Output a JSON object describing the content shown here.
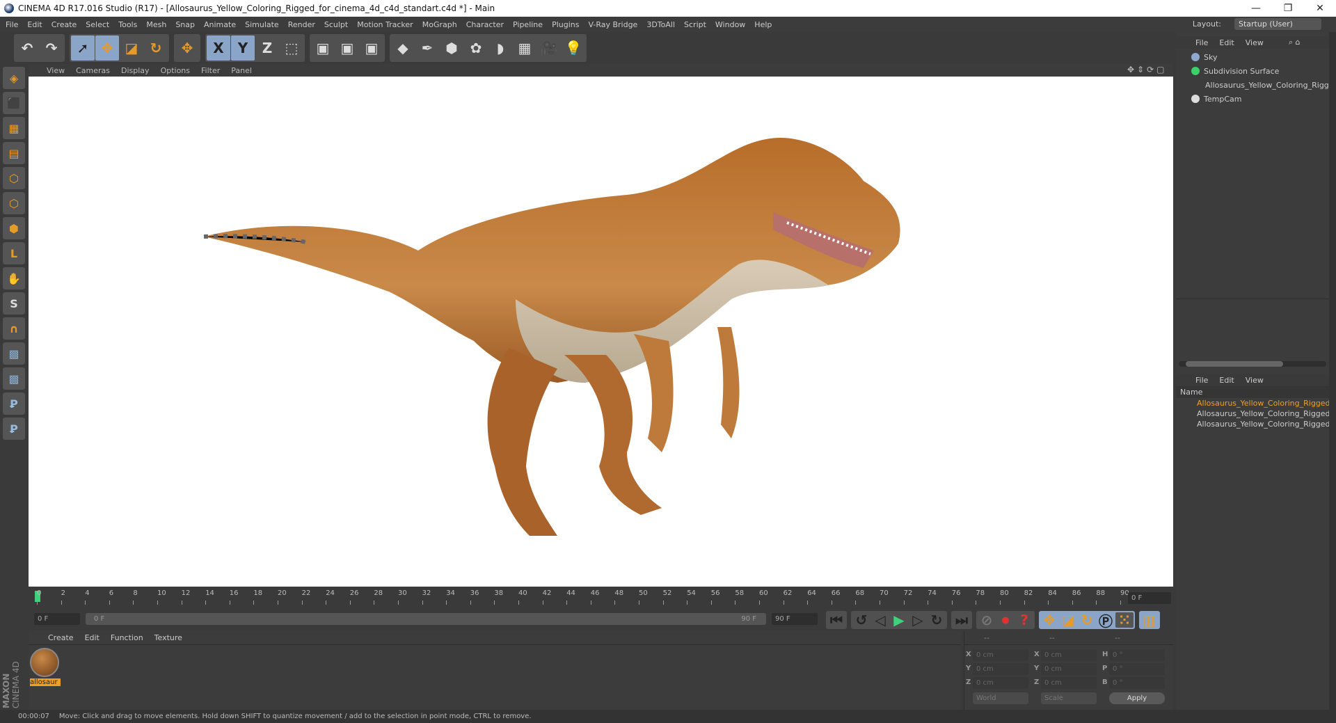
{
  "window": {
    "title": "CINEMA 4D R17.016 Studio (R17) - [Allosaurus_Yellow_Coloring_Rigged_for_cinema_4d_c4d_standart.c4d *] - Main",
    "minimize": "—",
    "restore": "❐",
    "close": "✕"
  },
  "menu": [
    "File",
    "Edit",
    "Create",
    "Select",
    "Tools",
    "Mesh",
    "Snap",
    "Animate",
    "Simulate",
    "Render",
    "Sculpt",
    "Motion Tracker",
    "MoGraph",
    "Character",
    "Pipeline",
    "Plugins",
    "V-Ray Bridge",
    "3DToAll",
    "Script",
    "Window",
    "Help"
  ],
  "layout": {
    "label": "Layout:",
    "value": "Startup (User)"
  },
  "toolbar": [
    {
      "group": [
        {
          "icon": "undo-icon",
          "g": "↶"
        },
        {
          "icon": "redo-icon",
          "g": "↷"
        }
      ]
    },
    {
      "group": [
        {
          "icon": "select-icon",
          "g": "➚",
          "on": true
        },
        {
          "icon": "move-icon",
          "g": "✥",
          "on": true
        },
        {
          "icon": "scale-icon",
          "g": "◪"
        },
        {
          "icon": "rotate-icon",
          "g": "↻"
        }
      ]
    },
    {
      "group": [
        {
          "icon": "transform-icon",
          "g": "✥"
        }
      ]
    },
    {
      "group": [
        {
          "icon": "x-axis-icon",
          "g": "X",
          "on": true
        },
        {
          "icon": "y-axis-icon",
          "g": "Y",
          "on": true
        },
        {
          "icon": "z-axis-icon",
          "g": "Z"
        },
        {
          "icon": "coordinate-system-icon",
          "g": "⬚"
        }
      ]
    },
    {
      "group": [
        {
          "icon": "render-view-icon",
          "g": "▣"
        },
        {
          "icon": "render-picture-viewer-icon",
          "g": "▣"
        },
        {
          "icon": "render-settings-icon",
          "g": "▣"
        }
      ]
    },
    {
      "group": [
        {
          "icon": "cube-icon",
          "g": "◆"
        },
        {
          "icon": "pen-spline-icon",
          "g": "✒"
        },
        {
          "icon": "subdivision-icon",
          "g": "⬢"
        },
        {
          "icon": "array-icon",
          "g": "✿"
        },
        {
          "icon": "deformer-icon",
          "g": "◗"
        },
        {
          "icon": "floor-icon",
          "g": "▦"
        },
        {
          "icon": "camera-icon",
          "g": "🎥"
        },
        {
          "icon": "light-icon",
          "g": "💡"
        }
      ]
    }
  ],
  "viewport": {
    "menu": [
      "View",
      "Cameras",
      "Display",
      "Options",
      "Filter",
      "Panel"
    ]
  },
  "timeline": {
    "ticks": [
      0,
      2,
      4,
      6,
      8,
      10,
      12,
      14,
      16,
      18,
      20,
      22,
      24,
      26,
      28,
      30,
      32,
      34,
      36,
      38,
      40,
      42,
      44,
      46,
      48,
      50,
      52,
      54,
      56,
      58,
      60,
      62,
      64,
      66,
      68,
      70,
      72,
      74,
      76,
      78,
      80,
      82,
      84,
      86,
      88,
      90
    ],
    "current_frame": "0 F",
    "start": "0 F",
    "range_start": "0 F",
    "range_end": "90 F",
    "end": "90 F"
  },
  "materials": {
    "menu": [
      "Create",
      "Edit",
      "Function",
      "Texture"
    ],
    "items": [
      {
        "name": "allosaur"
      }
    ]
  },
  "coords": {
    "headers": [
      "--",
      "--",
      "--"
    ],
    "rows": [
      {
        "a": "X",
        "v1": "0 cm",
        "b": "X",
        "v2": "0 cm",
        "c": "H",
        "v3": "0 °"
      },
      {
        "a": "Y",
        "v1": "0 cm",
        "b": "Y",
        "v2": "0 cm",
        "c": "P",
        "v3": "0 °"
      },
      {
        "a": "Z",
        "v1": "0 cm",
        "b": "Z",
        "v2": "0 cm",
        "c": "B",
        "v3": "0 °"
      }
    ],
    "world": "World",
    "scale": "Scale",
    "apply": "Apply"
  },
  "objects": {
    "menu": [
      "File",
      "Edit",
      "View"
    ],
    "items": [
      {
        "name": "Sky",
        "color": "#8fa8d0"
      },
      {
        "name": "Subdivision Surface",
        "color": "#3ccf6a"
      },
      {
        "name": "Allosaurus_Yellow_Coloring_Rigged",
        "color": "#cccccc"
      },
      {
        "name": "TempCam",
        "color": "#dddddd"
      }
    ]
  },
  "layers": {
    "menu": [
      "File",
      "Edit",
      "View"
    ],
    "header": "Name",
    "items": [
      {
        "name": "Allosaurus_Yellow_Coloring_Rigged",
        "color": "#d8692e",
        "active": true
      },
      {
        "name": "Allosaurus_Yellow_Coloring_Rigged",
        "color": "#e0d42a"
      },
      {
        "name": "Allosaurus_Yellow_Coloring_Rigged",
        "color": "#3fd2e0"
      }
    ]
  },
  "brand": {
    "line1": "MAXON",
    "line2": "CINEMA 4D"
  },
  "status": {
    "time": "00:00:07",
    "message": "Move: Click and drag to move elements. Hold down SHIFT to quantize movement / add to the selection in point mode, CTRL to remove."
  }
}
